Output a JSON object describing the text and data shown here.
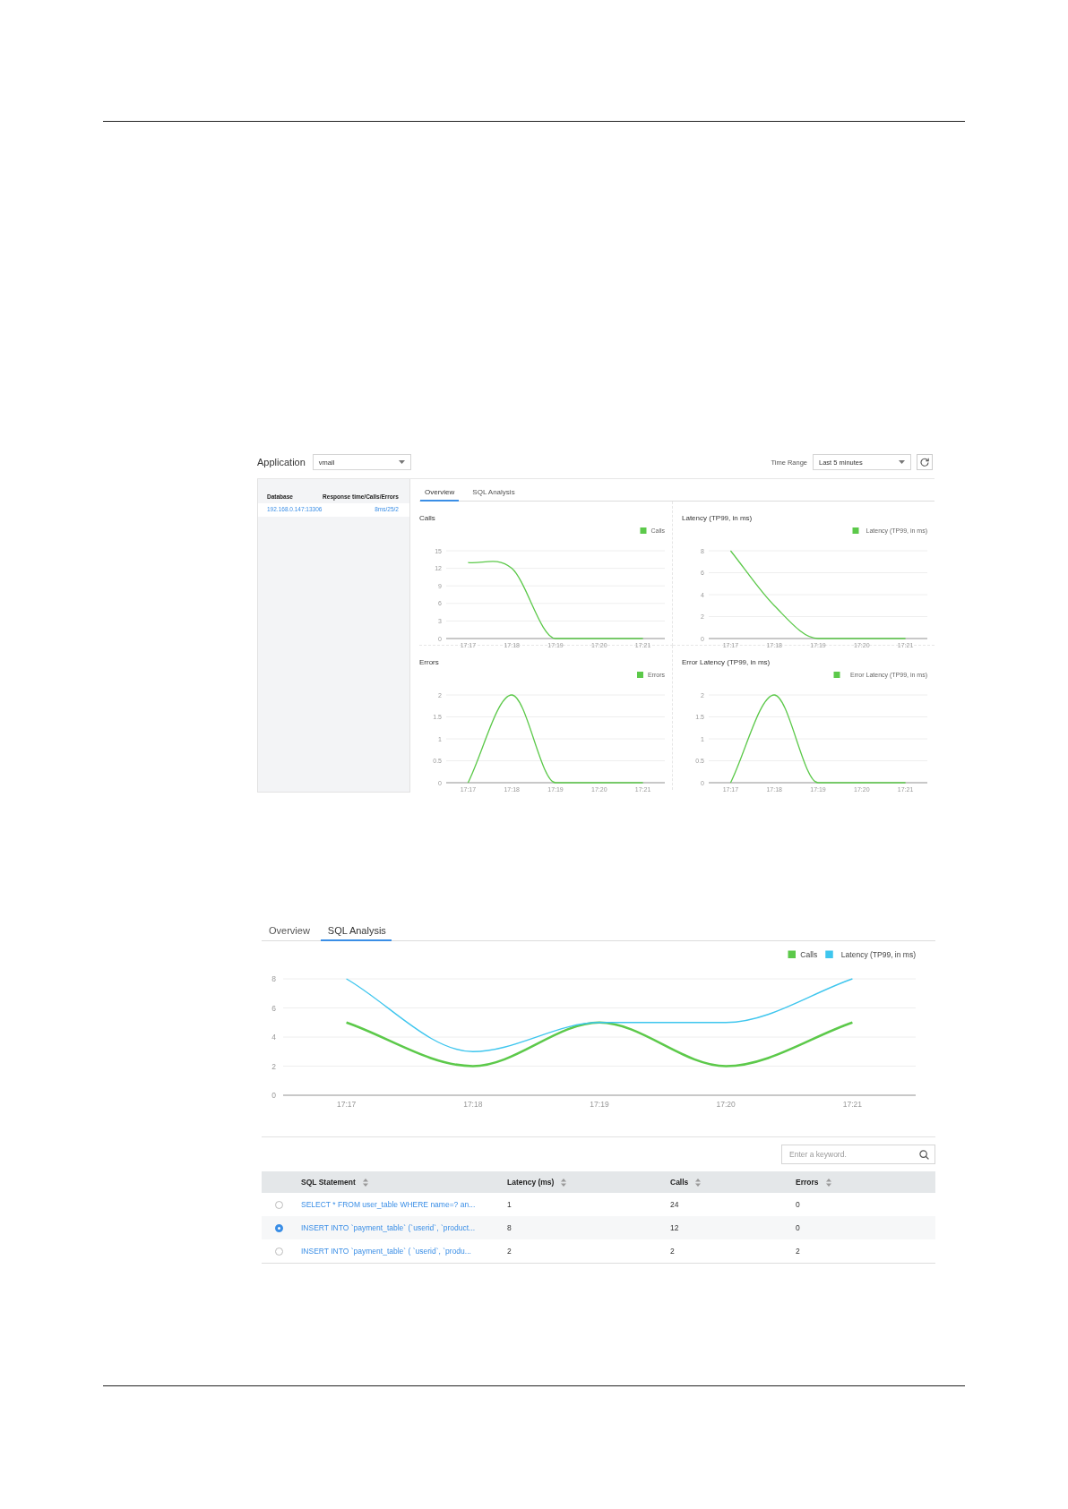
{
  "top_screenshot": {
    "application": {
      "label": "Application",
      "value": "vmall"
    },
    "time_range": {
      "label": "Time Range",
      "value": "Last 5 minutes"
    },
    "database_list": {
      "columns": [
        "Database",
        "Response time/Calls/Errors"
      ],
      "rows": [
        {
          "database": "192.168.0.147:13306",
          "stats": "8ms/25/2"
        }
      ]
    },
    "tabs": [
      {
        "label": "Overview",
        "selected": true
      },
      {
        "label": "SQL Analysis",
        "selected": false
      }
    ],
    "charts": [
      {
        "chart_data": {
          "type": "line",
          "grid": true,
          "legend": "top-right",
          "title": "Calls",
          "categories": [
            "17:17",
            "17:18",
            "17:19",
            "17:20",
            "17:21"
          ],
          "ylim": [
            0,
            15
          ],
          "yticks": [
            0,
            3,
            6,
            9,
            12,
            15
          ],
          "series": [
            {
              "name": "Calls",
              "color": "#5cc94a",
              "values": [
                13,
                12,
                0,
                0,
                0
              ]
            }
          ]
        }
      },
      {
        "chart_data": {
          "type": "line",
          "grid": true,
          "legend": "top-right",
          "title": "Latency (TP99, in ms)",
          "categories": [
            "17:17",
            "17:18",
            "17:19",
            "17:20",
            "17:21"
          ],
          "ylim": [
            0,
            8
          ],
          "yticks": [
            0,
            2,
            4,
            6,
            8
          ],
          "series": [
            {
              "name": "Latency (TP99, in ms)",
              "color": "#5cc94a",
              "values": [
                8,
                3,
                0,
                0,
                0
              ]
            }
          ]
        }
      },
      {
        "chart_data": {
          "type": "line",
          "grid": true,
          "legend": "top-right",
          "title": "Errors",
          "categories": [
            "17:17",
            "17:18",
            "17:19",
            "17:20",
            "17:21"
          ],
          "ylim": [
            0,
            2
          ],
          "yticks": [
            0,
            0.5,
            1,
            1.5,
            2
          ],
          "series": [
            {
              "name": "Errors",
              "color": "#5cc94a",
              "values": [
                0,
                2,
                0,
                0,
                0
              ]
            }
          ]
        }
      },
      {
        "chart_data": {
          "type": "line",
          "grid": true,
          "legend": "top-right",
          "title": "Error Latency (TP99, in ms)",
          "categories": [
            "17:17",
            "17:18",
            "17:19",
            "17:20",
            "17:21"
          ],
          "ylim": [
            0,
            2
          ],
          "yticks": [
            0,
            0.5,
            1,
            1.5,
            2
          ],
          "series": [
            {
              "name": "Error Latency (TP99, in ms)",
              "color": "#5cc94a",
              "values": [
                0,
                2,
                0,
                0,
                0
              ]
            }
          ]
        }
      }
    ]
  },
  "bottom_screenshot": {
    "tabs": [
      {
        "label": "Overview",
        "selected": false
      },
      {
        "label": "SQL Analysis",
        "selected": true
      }
    ],
    "chart_data": {
      "type": "line",
      "grid": true,
      "legend": "top-right",
      "categories": [
        "17:17",
        "17:18",
        "17:19",
        "17:20",
        "17:21"
      ],
      "ylim": [
        0,
        8
      ],
      "yticks": [
        0,
        2,
        4,
        6,
        8
      ],
      "series": [
        {
          "name": "Calls",
          "color": "#5cc94a",
          "values": [
            5,
            2,
            5,
            2,
            5
          ]
        },
        {
          "name": "Latency (TP99, in ms)",
          "color": "#3fc6ee",
          "values": [
            8,
            3,
            5,
            5,
            8
          ]
        }
      ]
    },
    "search": {
      "placeholder": "Enter a keyword."
    },
    "table": {
      "columns": [
        "SQL Statement",
        "Latency (ms)",
        "Calls",
        "Errors"
      ],
      "rows": [
        {
          "selected": false,
          "cells": [
            "SELECT * FROM user_table WHERE name=? an...",
            "1",
            "24",
            "0"
          ]
        },
        {
          "selected": true,
          "cells": [
            "INSERT INTO `payment_table` (`userid`, `product...",
            "8",
            "12",
            "0"
          ]
        },
        {
          "selected": false,
          "cells": [
            "INSERT INTO `payment_table`  ( `userid`, `produ...",
            "2",
            "2",
            "2"
          ]
        }
      ]
    }
  }
}
